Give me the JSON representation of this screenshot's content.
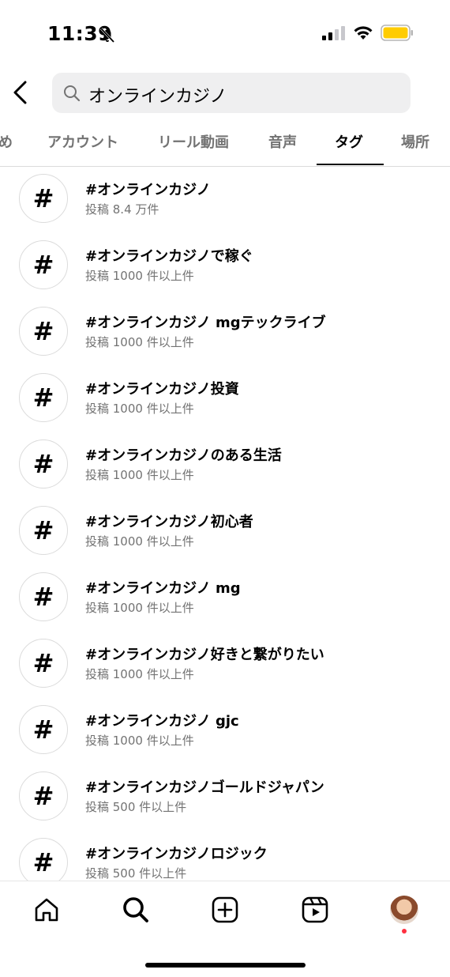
{
  "status_bar": {
    "time": "11:39"
  },
  "search": {
    "query": "オンラインカジノ"
  },
  "tabs": [
    {
      "label": "め"
    },
    {
      "label": "アカウント"
    },
    {
      "label": "リール動画"
    },
    {
      "label": "音声"
    },
    {
      "label": "タグ",
      "active": true
    },
    {
      "label": "場所"
    }
  ],
  "results": [
    {
      "tag": "#オンラインカジノ",
      "count": "投稿 8.4 万件"
    },
    {
      "tag": "#オンラインカジノで稼ぐ",
      "count": "投稿 1000 件以上件"
    },
    {
      "tag": "#オンラインカジノ mgテックライブ",
      "count": "投稿 1000 件以上件"
    },
    {
      "tag": "#オンラインカジノ投資",
      "count": "投稿 1000 件以上件"
    },
    {
      "tag": "#オンラインカジノのある生活",
      "count": "投稿 1000 件以上件"
    },
    {
      "tag": "#オンラインカジノ初心者",
      "count": "投稿 1000 件以上件"
    },
    {
      "tag": "#オンラインカジノ mg",
      "count": "投稿 1000 件以上件"
    },
    {
      "tag": "#オンラインカジノ好きと繋がりたい",
      "count": "投稿 1000 件以上件"
    },
    {
      "tag": "#オンラインカジノ gjc",
      "count": "投稿 1000 件以上件"
    },
    {
      "tag": "#オンラインカジノゴールドジャパン",
      "count": "投稿 500 件以上件"
    },
    {
      "tag": "#オンラインカジノロジック",
      "count": "投稿 500 件以上件"
    }
  ],
  "hash_symbol": "#",
  "colors": {
    "secondary_text": "#737373",
    "search_bg": "#efeff0",
    "battery": "#ffcc00",
    "notification_dot": "#ff3040"
  }
}
